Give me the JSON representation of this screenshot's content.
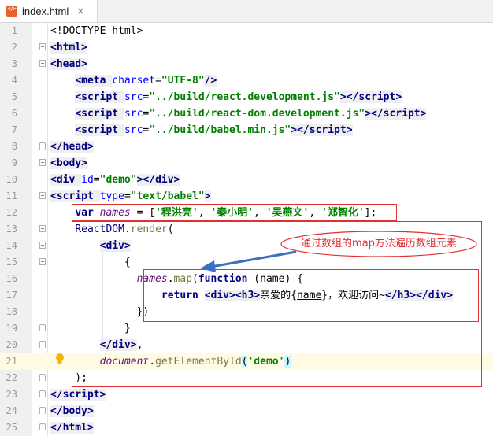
{
  "tab": {
    "filename": "index.html",
    "close": "×",
    "icon": "html-file-icon"
  },
  "current_line": 21,
  "lines": [
    {
      "n": "1"
    },
    {
      "n": "2"
    },
    {
      "n": "3"
    },
    {
      "n": "4"
    },
    {
      "n": "5"
    },
    {
      "n": "6"
    },
    {
      "n": "7"
    },
    {
      "n": "8"
    },
    {
      "n": "9"
    },
    {
      "n": "10"
    },
    {
      "n": "11"
    },
    {
      "n": "12"
    },
    {
      "n": "13"
    },
    {
      "n": "14"
    },
    {
      "n": "15"
    },
    {
      "n": "16"
    },
    {
      "n": "17"
    },
    {
      "n": "18"
    },
    {
      "n": "19"
    },
    {
      "n": "20"
    },
    {
      "n": "21"
    },
    {
      "n": "22"
    },
    {
      "n": "23"
    },
    {
      "n": "24"
    },
    {
      "n": "25"
    }
  ],
  "code": {
    "doctype": "<!DOCTYPE html>",
    "l5_src": "\"../build/react.development.js\"",
    "l6_src": "\"../build/react-dom.development.js\"",
    "l7_src": "\"../build/babel.min.js\"",
    "l8_charset": "\"UTF-8\"",
    "l10_id": "\"demo\"",
    "l11_type": "\"text/babel\"",
    "l12_n1": "'程洪亮'",
    "l12_n2": "'秦小明'",
    "l12_n3": "'吴燕文'",
    "l12_n4": "'郑智化'",
    "l16_name": "name",
    "l17_cn": "亲爱的",
    "l17_tail": "，欢迎访问~",
    "l21_demo": "'demo'"
  },
  "annotation": {
    "text": "通过数组的map方法遍历数组元素"
  },
  "colors": {
    "annotation_red": "#e0302f",
    "tag_navy": "#000080",
    "string_green": "#008000",
    "current_line": "#fffae3"
  }
}
